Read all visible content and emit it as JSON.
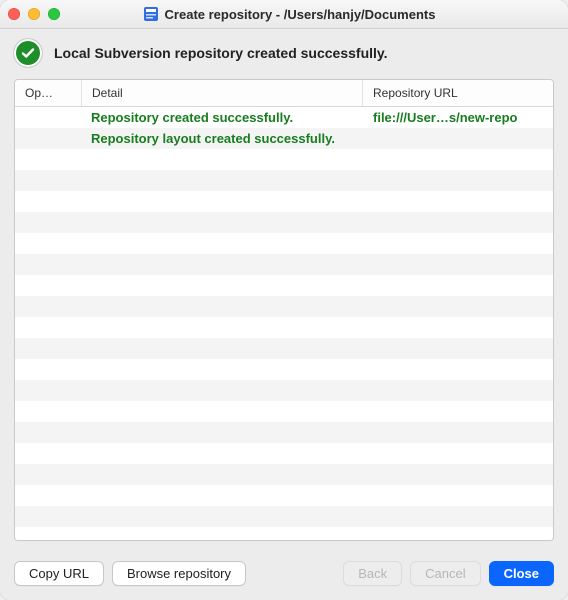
{
  "window": {
    "title": "Create repository - /Users/hanjy/Documents"
  },
  "banner": {
    "message": "Local Subversion repository created successfully."
  },
  "table": {
    "headers": {
      "op": "Op…",
      "detail": "Detail",
      "url": "Repository URL"
    },
    "rows": [
      {
        "op": "",
        "detail": "Repository created successfully.",
        "url": "file:///User…s/new-repo"
      },
      {
        "op": "",
        "detail": "Repository layout created successfully.",
        "url": ""
      }
    ],
    "blank_row_count": 19
  },
  "buttons": {
    "copy_url": "Copy URL",
    "browse": "Browse repository",
    "back": "Back",
    "cancel": "Cancel",
    "close": "Close"
  },
  "colors": {
    "success_green_text": "#177d1e",
    "success_badge": "#1e8e2a",
    "primary_blue": "#0a66ff"
  }
}
